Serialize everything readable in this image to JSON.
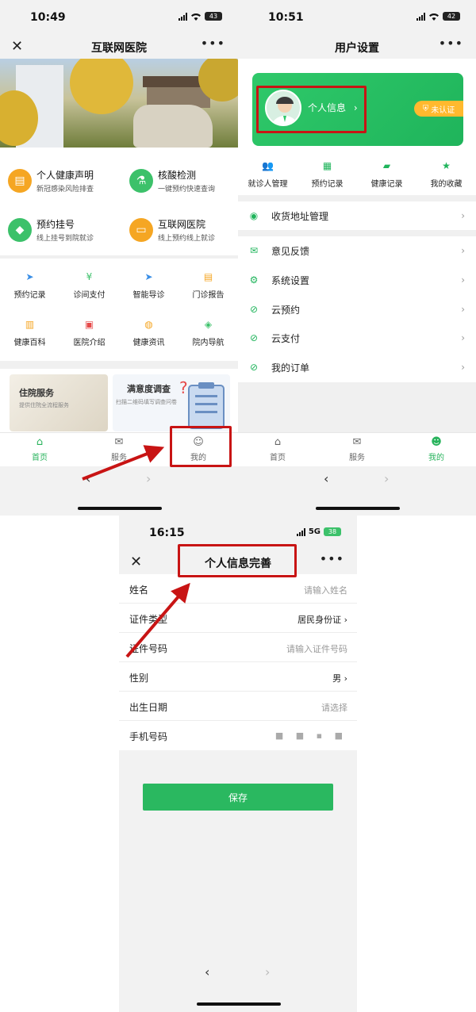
{
  "screen1": {
    "status": {
      "time": "10:49",
      "battery": "43"
    },
    "title": "互联网医院",
    "features": [
      {
        "title": "个人健康声明",
        "sub": "新冠感染风险排查",
        "color": "#f5a623",
        "icon": "document-icon"
      },
      {
        "title": "核酸检测",
        "sub": "一键预约快速查询",
        "color": "#3cc16a",
        "icon": "test-tube-icon"
      },
      {
        "title": "预约挂号",
        "sub": "线上挂号到院就诊",
        "color": "#3cc16a",
        "icon": "register-icon"
      },
      {
        "title": "互联网医院",
        "sub": "线上预约线上就诊",
        "color": "#f5a623",
        "icon": "monitor-icon"
      }
    ],
    "grid_row1": [
      {
        "label": "预约记录",
        "icon": "arrow-icon",
        "color": "#3a8ee6"
      },
      {
        "label": "诊间支付",
        "icon": "yen-icon",
        "color": "#3cc16a"
      },
      {
        "label": "智能导诊",
        "icon": "compass-icon",
        "color": "#3a8ee6"
      },
      {
        "label": "门诊报告",
        "icon": "report-icon",
        "color": "#f5a623"
      }
    ],
    "grid_row2": [
      {
        "label": "健康百科",
        "icon": "book-icon",
        "color": "#f5a623"
      },
      {
        "label": "医院介绍",
        "icon": "hospital-icon",
        "color": "#e64a4a"
      },
      {
        "label": "健康资讯",
        "icon": "globe-icon",
        "color": "#f5a623"
      },
      {
        "label": "院内导航",
        "icon": "navigation-icon",
        "color": "#3cc16a"
      }
    ],
    "cards": [
      {
        "title": "住院服务",
        "sub": "提供住院全流程服务"
      },
      {
        "title": "满意度调查",
        "sub": "扫描二维码填写调查问卷"
      }
    ],
    "tabs": [
      {
        "label": "首页",
        "icon": "home-icon"
      },
      {
        "label": "服务",
        "icon": "mail-icon"
      },
      {
        "label": "我的",
        "icon": "user-icon"
      }
    ]
  },
  "screen2": {
    "status": {
      "time": "10:51",
      "battery": "42"
    },
    "title": "用户设置",
    "profile_label": "个人信息",
    "badge": "未认证",
    "quick": [
      {
        "label": "就诊人管理",
        "icon": "people-icon"
      },
      {
        "label": "预约记录",
        "icon": "calendar-icon"
      },
      {
        "label": "健康记录",
        "icon": "folder-icon"
      },
      {
        "label": "我的收藏",
        "icon": "star-icon"
      }
    ],
    "address": "收货地址管理",
    "menu": [
      {
        "label": "意见反馈",
        "icon": "mail-icon"
      },
      {
        "label": "系统设置",
        "icon": "gear-icon"
      },
      {
        "label": "云预约",
        "icon": "link-icon"
      },
      {
        "label": "云支付",
        "icon": "link-icon"
      },
      {
        "label": "我的订单",
        "icon": "link-icon"
      }
    ],
    "tabs": [
      {
        "label": "首页",
        "icon": "home-icon"
      },
      {
        "label": "服务",
        "icon": "mail-icon"
      },
      {
        "label": "我的",
        "icon": "user-icon"
      }
    ]
  },
  "screen3": {
    "status": {
      "time": "16:15",
      "network": "5G",
      "battery": "38"
    },
    "title": "个人信息完善",
    "fields": [
      {
        "label": "姓名",
        "value": "请输入姓名",
        "kind": "placeholder"
      },
      {
        "label": "证件类型",
        "value": "居民身份证",
        "kind": "select"
      },
      {
        "label": "证件号码",
        "value": "请输入证件号码",
        "kind": "placeholder"
      },
      {
        "label": "性别",
        "value": "男",
        "kind": "select"
      },
      {
        "label": "出生日期",
        "value": "请选择",
        "kind": "placeholder"
      },
      {
        "label": "手机号码",
        "value": "",
        "kind": "masked"
      }
    ],
    "save": "保存"
  },
  "colors": {
    "accent": "#2ab860",
    "highlight": "#c81414",
    "warning": "#ffb92e"
  }
}
